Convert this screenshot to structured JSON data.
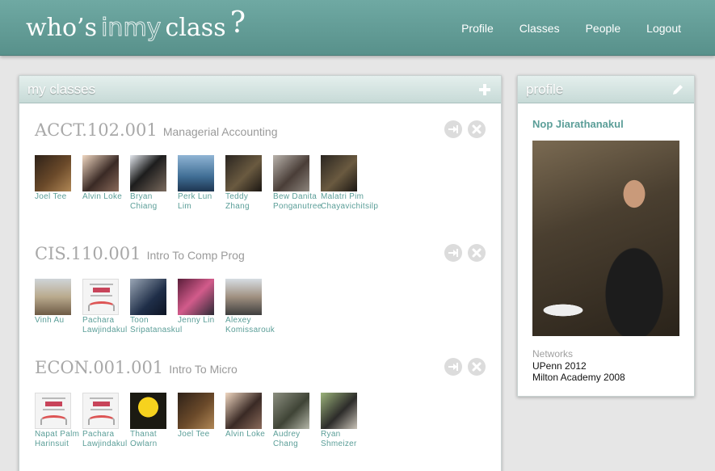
{
  "header": {
    "logo": {
      "part1": "who’s",
      "part2": "inmy",
      "part3": "class",
      "part4": "?"
    },
    "nav": [
      "Profile",
      "Classes",
      "People",
      "Logout"
    ]
  },
  "my_classes": {
    "title": "my classes",
    "add_icon": "plus-icon",
    "sections": [
      {
        "code": "ACCT.102.001",
        "name": "Managerial Accounting",
        "people": [
          {
            "name": "Joel Tee",
            "thumb": "t-dark"
          },
          {
            "name": "Alvin Loke",
            "thumb": "t-warm"
          },
          {
            "name": "Bryan Chiang",
            "thumb": "t-bright"
          },
          {
            "name": "Perk Lun Lim",
            "thumb": "t-blue"
          },
          {
            "name": "Teddy Zhang",
            "thumb": "t-night"
          },
          {
            "name": "Bew Danita Ponganutree",
            "thumb": "t-grey"
          },
          {
            "name": "Malatri Pim Chayavichitsilp",
            "thumb": "t-night"
          }
        ]
      },
      {
        "code": "CIS.110.001",
        "name": "Intro To Comp Prog",
        "people": [
          {
            "name": "Vinh Au",
            "thumb": "t-desert"
          },
          {
            "name": "Pachara Lawjindakul",
            "thumb": "t-poster"
          },
          {
            "name": "Toon Sripatanaskul",
            "thumb": "t-navy"
          },
          {
            "name": "Jenny Lin",
            "thumb": "t-pink"
          },
          {
            "name": "Alexey Komissarouk",
            "thumb": "t-sky"
          }
        ]
      },
      {
        "code": "ECON.001.001",
        "name": "Intro To Micro",
        "people": [
          {
            "name": "Napat Palm Harinsuit",
            "thumb": "t-poster"
          },
          {
            "name": "Pachara Lawjindakul",
            "thumb": "t-poster"
          },
          {
            "name": "Thanat Owlarn",
            "thumb": "t-yellow"
          },
          {
            "name": "Joel Tee",
            "thumb": "t-dark"
          },
          {
            "name": "Alvin Loke",
            "thumb": "t-warm"
          },
          {
            "name": "Audrey Chang",
            "thumb": "t-street"
          },
          {
            "name": "Ryan Shmeizer",
            "thumb": "t-green"
          }
        ]
      }
    ]
  },
  "profile": {
    "title": "profile",
    "edit_icon": "pencil-icon",
    "name": "Nop Jiarathanakul",
    "networks_label": "Networks",
    "networks": [
      "UPenn 2012",
      "Milton Academy 2008"
    ]
  },
  "colors": {
    "header": "#62a19b",
    "link": "#5b9e98",
    "course": "#a8a8a8"
  }
}
